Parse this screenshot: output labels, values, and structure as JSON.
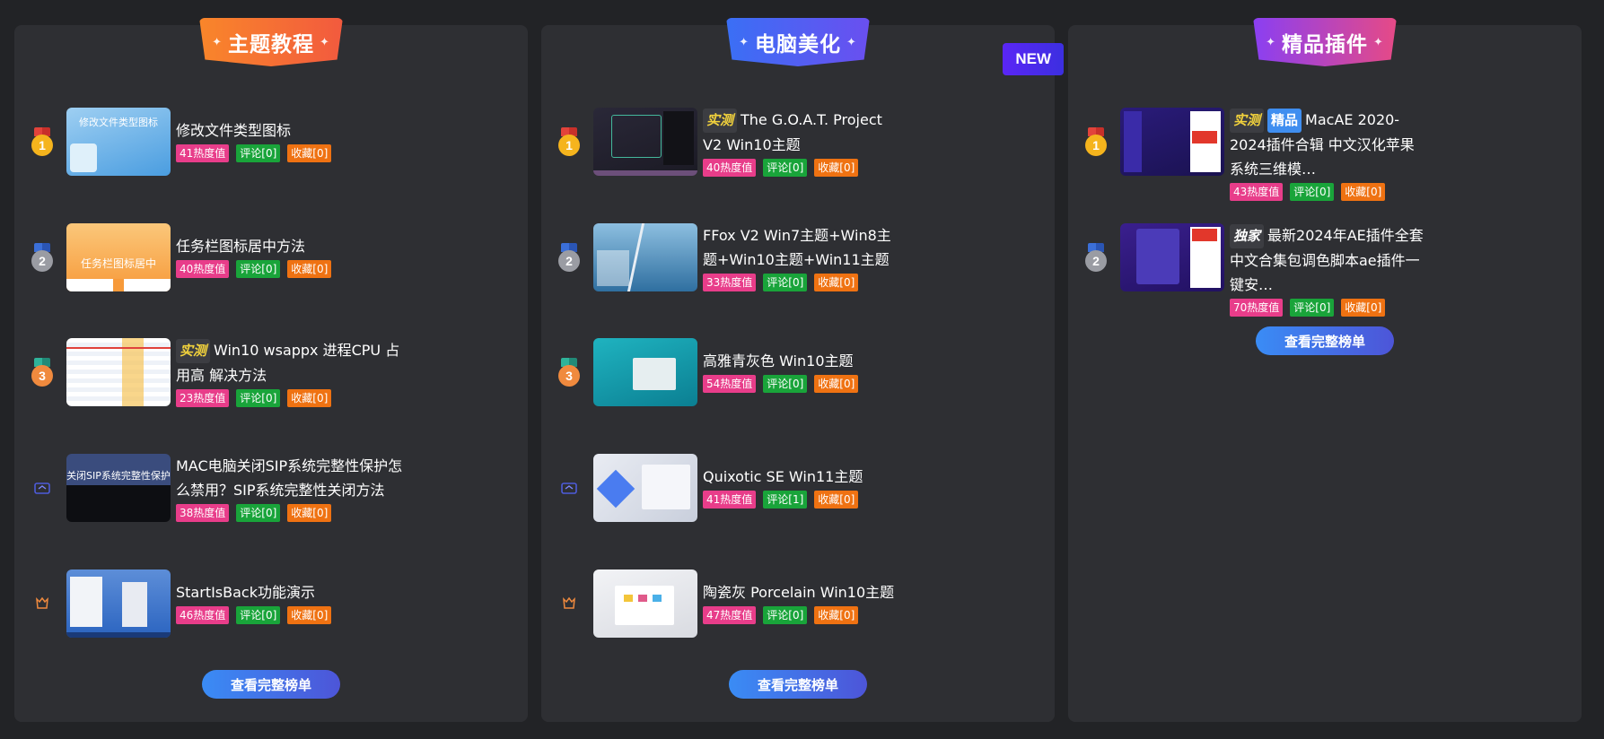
{
  "columns": [
    {
      "title": "主题教程",
      "more_label": "查看完整榜单",
      "items": [
        {
          "rank": "1",
          "thumb_text": "修改文件类型图标",
          "title": "修改文件类型图标",
          "heat": "41热度值",
          "comments": "评论[0]",
          "favorites": "收藏[0]"
        },
        {
          "rank": "2",
          "thumb_text": "任务栏图标居中",
          "title": "任务栏图标居中方法",
          "heat": "40热度值",
          "comments": "评论[0]",
          "favorites": "收藏[0]"
        },
        {
          "rank": "3",
          "tag": "实测",
          "title": "Win10 wsappx 进程CPU 占用高 解决方法",
          "heat": "23热度值",
          "comments": "评论[0]",
          "favorites": "收藏[0]"
        },
        {
          "icon": "crown-icon",
          "thumb_text": "关闭SIP系统完整性保护",
          "title": "MAC电脑关闭SIP系统完整性保护怎么禁用？SIP系统完整性关闭方法",
          "heat": "38热度值",
          "comments": "评论[0]",
          "favorites": "收藏[0]"
        },
        {
          "icon": "trophy-icon",
          "title": "StartIsBack功能演示",
          "heat": "46热度值",
          "comments": "评论[0]",
          "favorites": "收藏[0]"
        }
      ]
    },
    {
      "title": "电脑美化",
      "new_badge": "NEW",
      "more_label": "查看完整榜单",
      "items": [
        {
          "rank": "1",
          "tag": "实测",
          "title": "The G.O.A.T. Project V2 Win10主题",
          "heat": "40热度值",
          "comments": "评论[0]",
          "favorites": "收藏[0]"
        },
        {
          "rank": "2",
          "title": "FFox V2 Win7主题+Win8主题+Win10主题+Win11主题",
          "heat": "33热度值",
          "comments": "评论[0]",
          "favorites": "收藏[0]"
        },
        {
          "rank": "3",
          "title": "高雅青灰色 Win10主题",
          "heat": "54热度值",
          "comments": "评论[0]",
          "favorites": "收藏[0]"
        },
        {
          "icon": "crown-icon",
          "title": "Quixotic SE Win11主题",
          "heat": "41热度值",
          "comments": "评论[1]",
          "favorites": "收藏[0]"
        },
        {
          "icon": "trophy-icon",
          "title": "陶瓷灰 Porcelain Win10主题",
          "heat": "47热度值",
          "comments": "评论[0]",
          "favorites": "收藏[0]"
        }
      ]
    },
    {
      "title": "精品插件",
      "more_label": "查看完整榜单",
      "items": [
        {
          "rank": "1",
          "tag": "实测",
          "tag2": "精品",
          "title": "MacAE 2020-2024插件合辑 中文汉化苹果系统三维模…",
          "heat": "43热度值",
          "comments": "评论[0]",
          "favorites": "收藏[0]"
        },
        {
          "rank": "2",
          "tag": "独家",
          "title": "最新2024年AE插件全套中文合集包调色脚本ae插件一键安…",
          "heat": "70热度值",
          "comments": "评论[0]",
          "favorites": "收藏[0]"
        }
      ]
    }
  ]
}
